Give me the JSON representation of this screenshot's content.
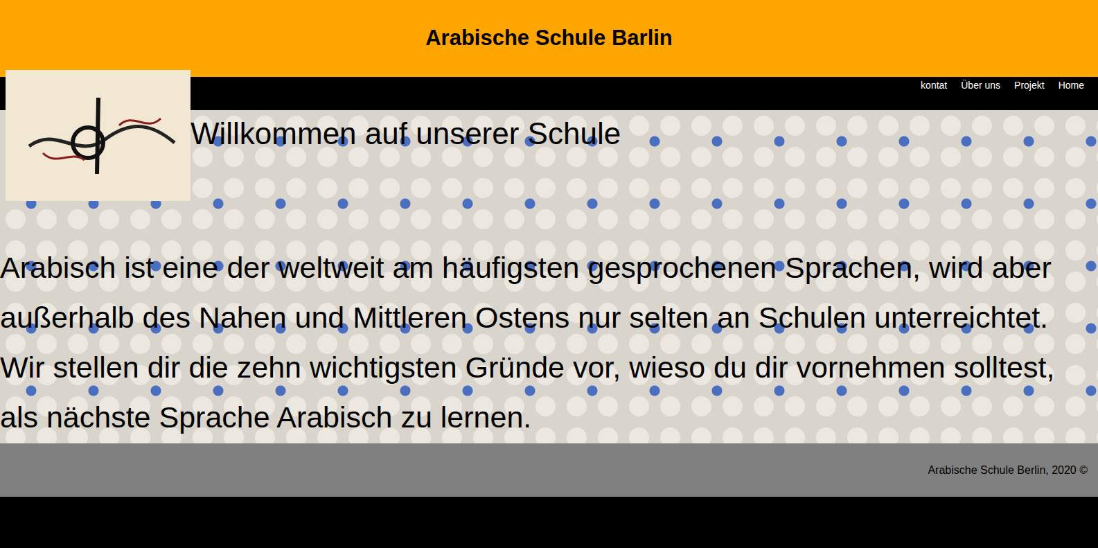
{
  "header": {
    "title": "Arabische Schule Barlin"
  },
  "nav": {
    "links": [
      {
        "label": "kontat"
      },
      {
        "label": "Über uns"
      },
      {
        "label": "Projekt"
      },
      {
        "label": "Home"
      }
    ]
  },
  "main": {
    "heading": "Willkommen auf unserer Schule",
    "paragraph": "Arabisch ist eine der weltweit am häufigsten gesprochenen Sprachen, wird aber außerhalb des Nahen und Mittleren Ostens nur selten an Schulen unterreichtet. Wir stellen dir die zehn wichtigsten Gründe vor, wieso du dir vornehmen solltest, als nächste Sprache Arabisch zu lernen."
  },
  "footer": {
    "text": "Arabische Schule Berlin, 2020 ©"
  }
}
